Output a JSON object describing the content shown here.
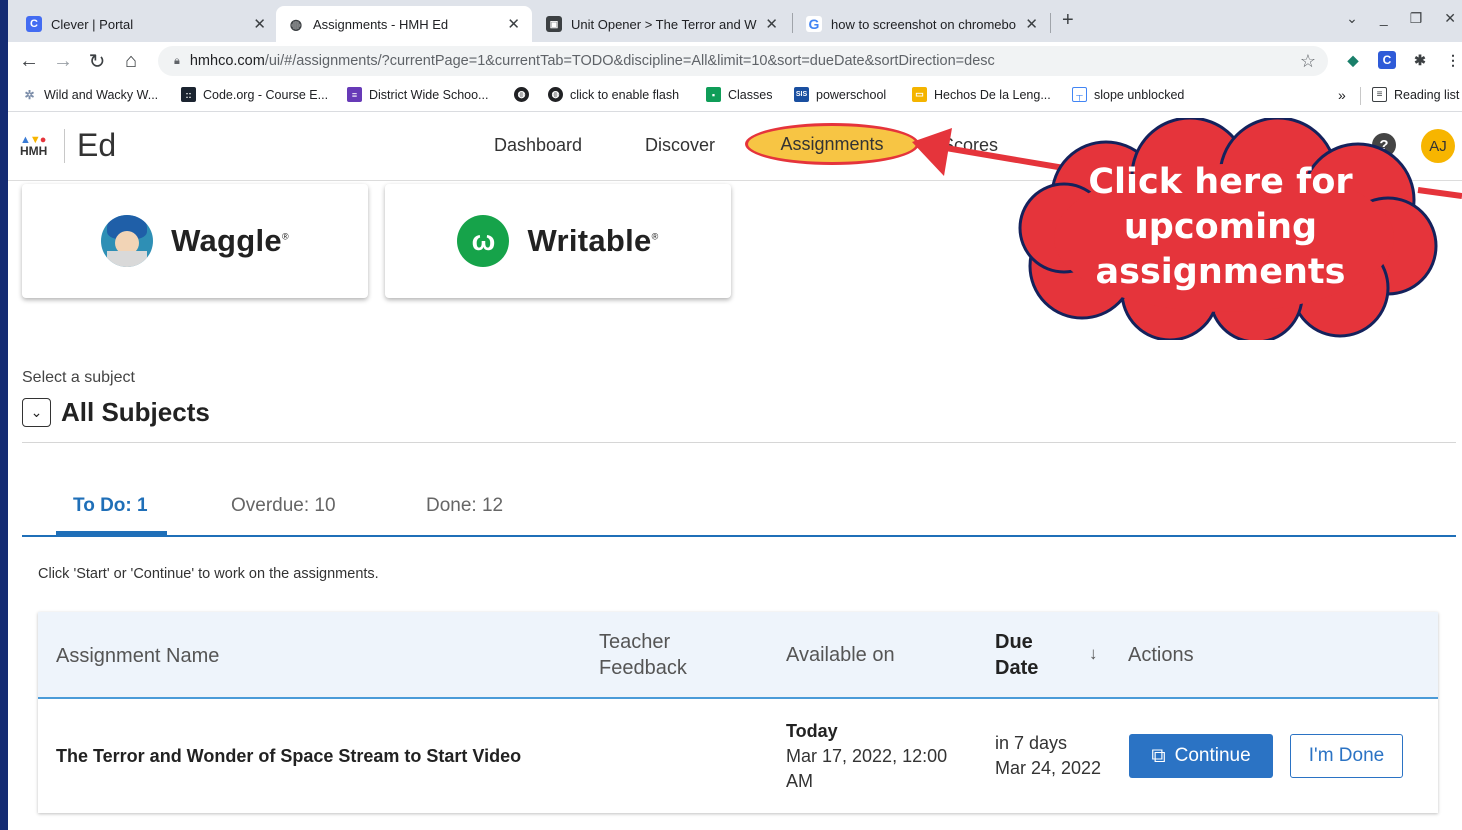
{
  "browser": {
    "tabs": [
      {
        "title": "Clever | Portal",
        "favicon": "C"
      },
      {
        "title": "Assignments - HMH Ed",
        "favicon": "globe"
      },
      {
        "title": "Unit Opener > The Terror and Wo",
        "favicon": "film"
      },
      {
        "title": "how to screenshot on chromebo",
        "favicon": "G"
      }
    ],
    "new_tab": "+",
    "url_domain": "hmhco.com",
    "url_path": "/ui/#/assignments/?currentPage=1&currentTab=TODO&discipline=All&limit=10&sort=dueDate&sortDirection=desc",
    "bookmarks": [
      {
        "label": "Wild and Wacky W..."
      },
      {
        "label": "Code.org - Course E..."
      },
      {
        "label": "District Wide Schoo..."
      },
      {
        "label": ""
      },
      {
        "label": "click to enable flash"
      },
      {
        "label": "Classes"
      },
      {
        "label": "powerschool"
      },
      {
        "label": "Hechos De la Leng..."
      },
      {
        "label": "slope unblocked"
      }
    ],
    "bookmarks_more": "»",
    "reading_list": "Reading list"
  },
  "app": {
    "logo_small": "HMH",
    "logo_ed": "Ed",
    "nav": {
      "dashboard": "Dashboard",
      "discover": "Discover",
      "assignments": "Assignments",
      "scores": "Scores"
    },
    "help": "?",
    "avatar_initials": "AJ",
    "accent_color": "#1f6fb8",
    "highlight_color": "#f7c544"
  },
  "cards": [
    {
      "label": "Waggle",
      "mark": "®"
    },
    {
      "label": "Writable",
      "mark": "®"
    }
  ],
  "subject": {
    "label": "Select a subject",
    "value": "All Subjects"
  },
  "tabs": {
    "todo": "To Do: 1",
    "overdue": "Overdue: 10",
    "done": "Done: 12"
  },
  "instructions": "Click 'Start' or 'Continue' to work on the assignments.",
  "table": {
    "headers": {
      "name": "Assignment Name",
      "feedback_1": "Teacher",
      "feedback_2": "Feedback",
      "available": "Available on",
      "due_1": "Due",
      "due_2": "Date",
      "sort_icon": "↓",
      "actions": "Actions"
    },
    "rows": [
      {
        "name": "The Terror and Wonder of Space Stream to Start Video",
        "available_1": "Today",
        "available_2": "Mar 17, 2022, 12:00",
        "available_3": "AM",
        "due_1": "in 7 days",
        "due_2": "Mar 24, 2022",
        "continue_label": "Continue",
        "done_label": "I'm Done"
      }
    ]
  },
  "annotation": {
    "line1": "Click here for",
    "line2": "upcoming",
    "line3": "assignments",
    "color": "#e5343b"
  }
}
